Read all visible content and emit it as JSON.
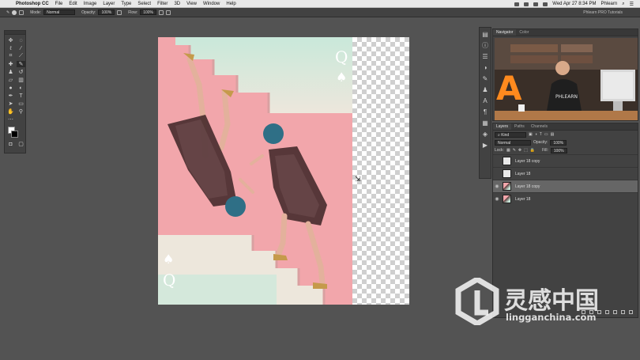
{
  "menubar": {
    "app_name": "Photoshop CC",
    "items": [
      "File",
      "Edit",
      "Image",
      "Layer",
      "Type",
      "Select",
      "Filter",
      "3D",
      "View",
      "Window",
      "Help"
    ],
    "clock": "Wed Apr 27  8:34 PM",
    "user": "Phlearn"
  },
  "options": {
    "mode_label": "Mode:",
    "mode_value": "Normal",
    "opacity_label": "Opacity:",
    "opacity_value": "100%",
    "flow_label": "Flow:",
    "flow_value": "100%",
    "document_title": "Phlearn PRO Tutorials"
  },
  "panels": {
    "navigator_tabs": [
      "Navigator",
      "Color"
    ],
    "navigator_sign": "PHLEARN",
    "layers_tabs": [
      "Layers",
      "Paths",
      "Channels"
    ],
    "kind_label": "Kind",
    "blend_mode": "Normal",
    "opacity_label": "Opacity:",
    "opacity_value": "100%",
    "lock_label": "Lock:",
    "fill_label": "Fill:",
    "fill_value": "100%",
    "layers": [
      {
        "name": "Layer 18 copy",
        "visible": false,
        "selected": false,
        "thumb": "blank"
      },
      {
        "name": "Layer 18",
        "visible": false,
        "selected": false,
        "thumb": "blank"
      },
      {
        "name": "Layer 18 copy",
        "visible": true,
        "selected": true,
        "thumb": "photo"
      },
      {
        "name": "Layer 18",
        "visible": true,
        "selected": false,
        "thumb": "photo"
      }
    ]
  },
  "canvas": {
    "card_letter": "Q",
    "card_suit": "♠",
    "colors": {
      "pink": "#f2a6ab",
      "mint": "#c9e8da",
      "cream": "#ede7dc",
      "hair": "#2f6f86",
      "gold": "#c59a4b"
    }
  },
  "watermark": {
    "chinese": "灵感中国",
    "url": "lingganchina.com"
  }
}
